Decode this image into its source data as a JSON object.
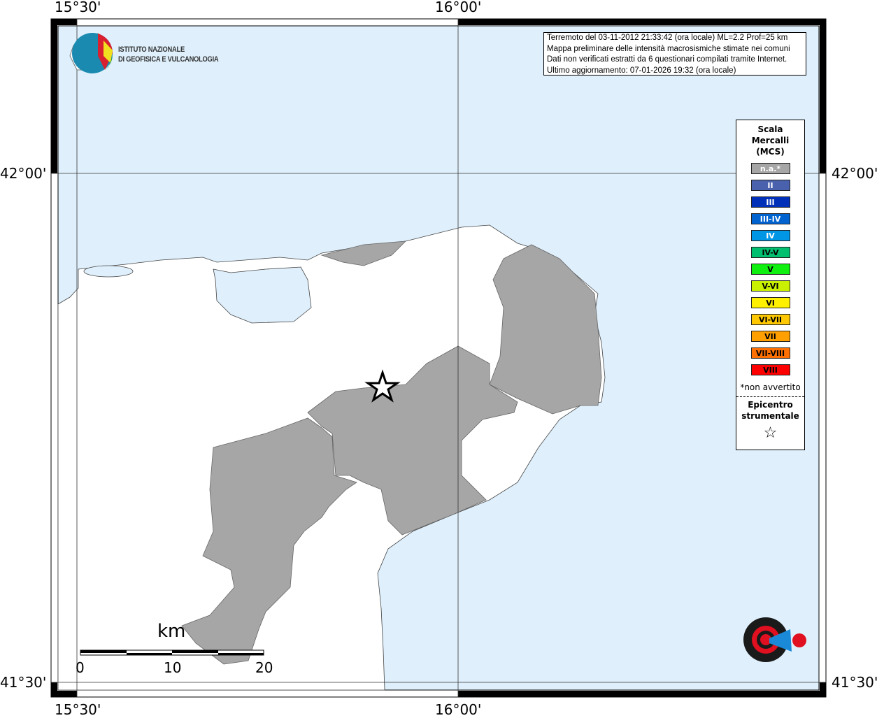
{
  "axes": {
    "lon_labels": [
      "15°30'",
      "16°00'"
    ],
    "lat_labels": [
      "42°00'",
      "41°30'"
    ]
  },
  "info": {
    "lines": [
      "Terremoto del 03-11-2012 21:33:42 (ora locale) ML=2.2 Prof=25 km",
      "Mappa preliminare delle intensità macrosismiche stimate nei comuni",
      "Dati non verificati estratti da 6 questionari compilati tramite Internet.",
      "Ultimo aggiornamento: 07-01-2026 19:32 (ora locale)"
    ]
  },
  "logo": {
    "ingv_line1": "ISTITUTO NAZIONALE",
    "ingv_line2": "DI GEOFISICA E VULCANOLOGIA",
    "hsit": "www.haisentitoilterremoto.it"
  },
  "legend": {
    "title": [
      "Scala",
      "Mercalli",
      "(MCS)"
    ],
    "items": [
      {
        "label": "n.a.*",
        "color": "#a6a6a6",
        "text": "#fff"
      },
      {
        "label": "II",
        "color": "#4a62ad",
        "text": "#fff"
      },
      {
        "label": "III",
        "color": "#0030b8",
        "text": "#fff"
      },
      {
        "label": "III-IV",
        "color": "#0063d0",
        "text": "#fff"
      },
      {
        "label": "IV",
        "color": "#0096e6",
        "text": "#fff"
      },
      {
        "label": "IV-V",
        "color": "#00c070",
        "text": "#000"
      },
      {
        "label": "V",
        "color": "#10f010",
        "text": "#000"
      },
      {
        "label": "V-VI",
        "color": "#c8f000",
        "text": "#000"
      },
      {
        "label": "VI",
        "color": "#fff000",
        "text": "#000"
      },
      {
        "label": "VI-VII",
        "color": "#ffc800",
        "text": "#000"
      },
      {
        "label": "VII",
        "color": "#ffa000",
        "text": "#000"
      },
      {
        "label": "VII-VIII",
        "color": "#ff7000",
        "text": "#000"
      },
      {
        "label": "VIII",
        "color": "#ff0000",
        "text": "#000"
      }
    ],
    "note": "*non avvertito",
    "epicenter": [
      "Epicentro",
      "strumentale"
    ],
    "star": "☆"
  },
  "scale": {
    "unit": "km",
    "ticks": [
      "0",
      "10",
      "20"
    ]
  },
  "colors": {
    "sea": "#dff0fc",
    "land": "#ffffff",
    "felt": "#a6a6a6"
  }
}
